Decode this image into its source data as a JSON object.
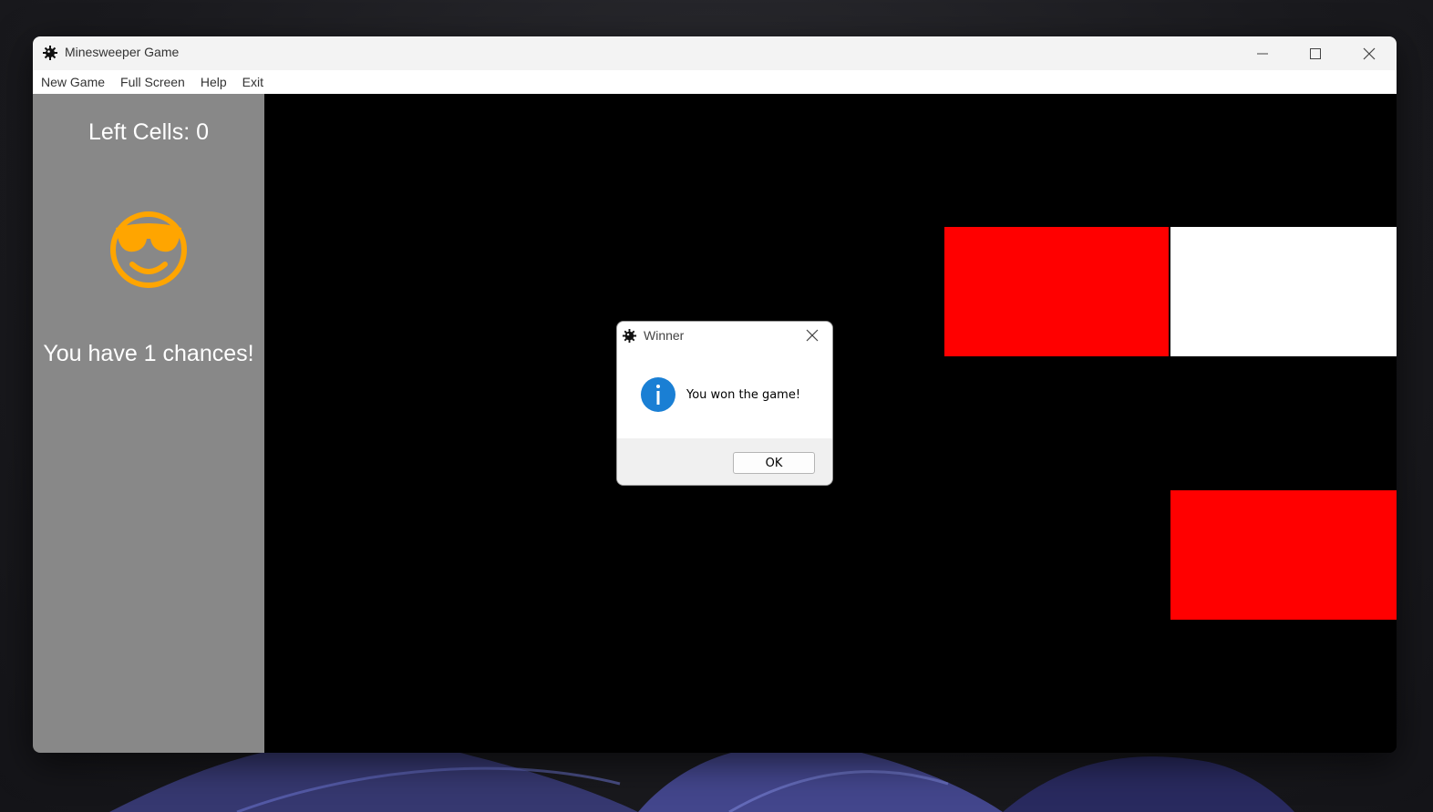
{
  "window": {
    "title": "Minesweeper Game",
    "app_icon": "mine-icon",
    "controls": [
      "minimize-icon",
      "maximize-icon",
      "close-icon"
    ]
  },
  "menu": {
    "items": [
      {
        "label": "New Game"
      },
      {
        "label": "Full Screen"
      },
      {
        "label": "Help"
      },
      {
        "label": "Exit"
      }
    ]
  },
  "sidebar": {
    "left_cells": "Left Cells: 0",
    "face_icon": "smiley-sunglasses-icon",
    "chances": "You have 1 chances!"
  },
  "board": {
    "cells": [
      {
        "state": "red",
        "color": "#ff0000"
      },
      {
        "state": "white",
        "color": "#ffffff"
      },
      {
        "state": "red",
        "color": "#ff0000"
      }
    ]
  },
  "dialog": {
    "title": "Winner",
    "message": "You won the game!",
    "ok_label": "OK",
    "icon": "info-icon"
  },
  "colors": {
    "sidebar_bg": "#888888",
    "board_bg": "#000000",
    "smiley": "#ffa500",
    "info_blue": "#1a7fd4"
  }
}
